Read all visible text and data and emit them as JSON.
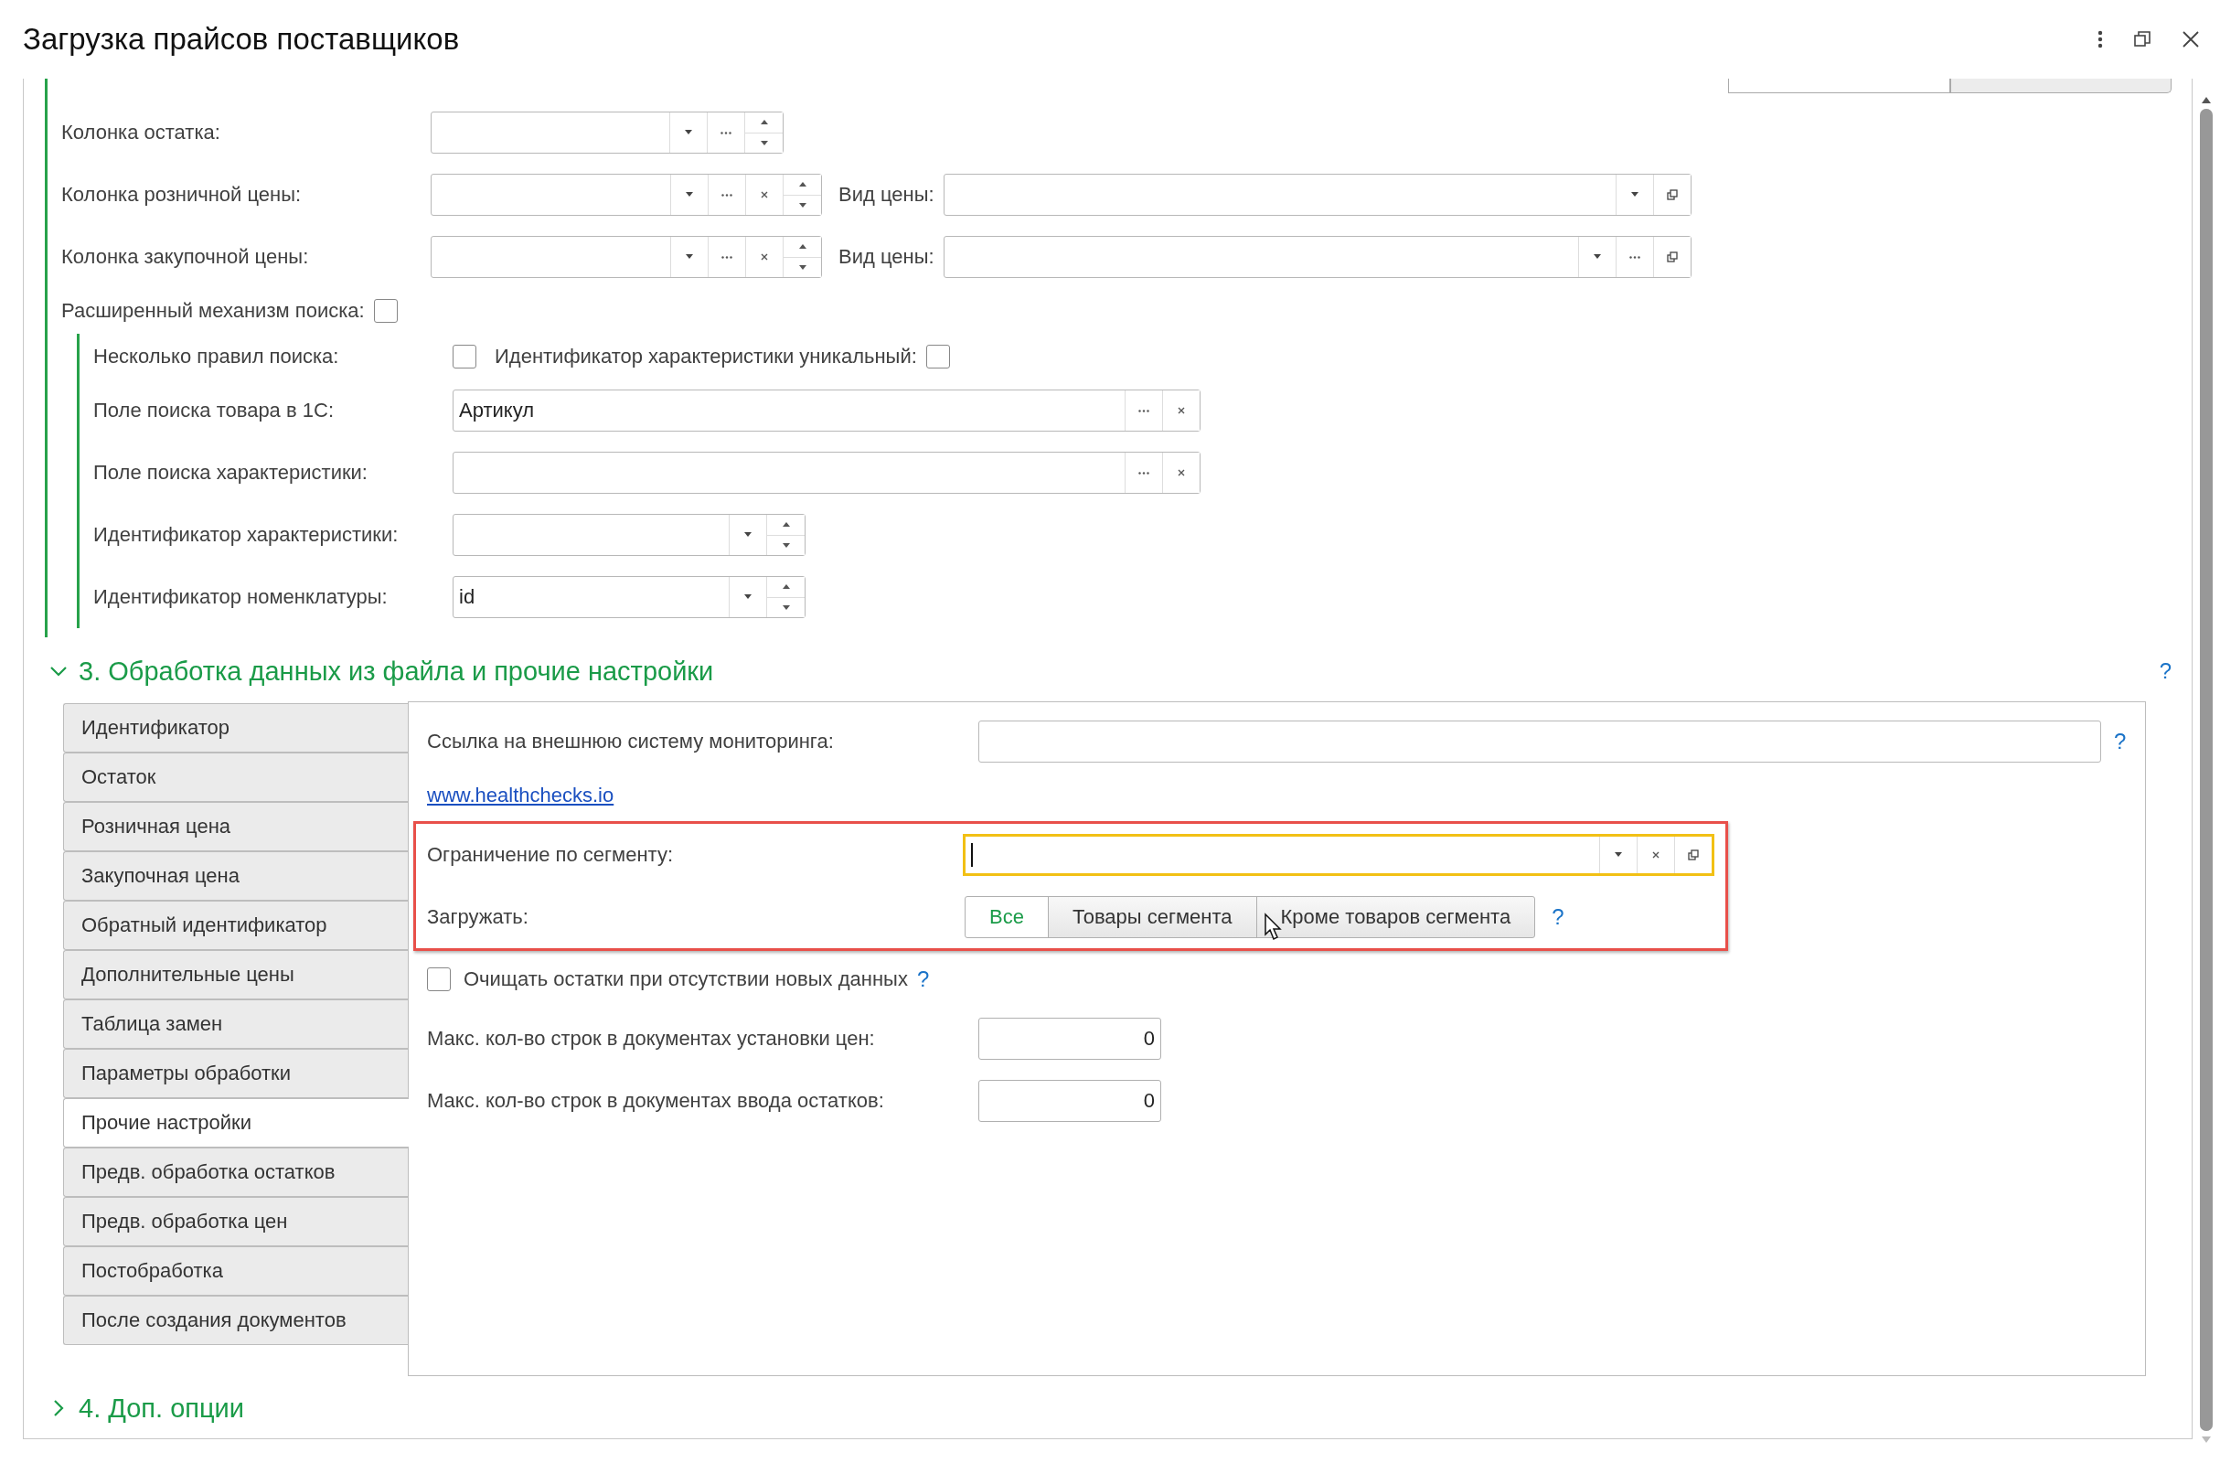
{
  "window": {
    "title": "Загрузка прайсов поставщиков"
  },
  "columns": {
    "rows": [
      {
        "kind": "field",
        "label": "Колонка остатка:",
        "buttons": [
          {
            "kind": "dropdown"
          },
          {
            "kind": "choice"
          },
          {
            "kind": "spin"
          }
        ]
      },
      {
        "kind": "field",
        "label": "Колонка розничной цены:",
        "buttons": [
          {
            "kind": "dropdown"
          },
          {
            "kind": "choice"
          },
          {
            "kind": "clear"
          },
          {
            "kind": "spin"
          }
        ],
        "extra": {
          "label": "Вид цены:",
          "buttons": [
            {
              "kind": "dropdown"
            },
            {
              "kind": "open"
            }
          ]
        }
      },
      {
        "kind": "field",
        "label": "Колонка закупочной цены:",
        "buttons": [
          {
            "kind": "dropdown"
          },
          {
            "kind": "choice"
          },
          {
            "kind": "clear"
          },
          {
            "kind": "spin"
          }
        ],
        "extra": {
          "label": "Вид цены:",
          "buttons": [
            {
              "kind": "dropdown"
            },
            {
              "kind": "choice"
            },
            {
              "kind": "open"
            }
          ]
        }
      },
      {
        "kind": "checkbox",
        "label": "Расширенный механизм поиска:",
        "checked": false
      }
    ]
  },
  "search": {
    "rows": [
      {
        "kind": "checkboxes",
        "items": [
          {
            "label": "Несколько правил поиска:",
            "checked": false
          },
          {
            "label": "Идентификатор характеристики уникальный:",
            "checked": false
          }
        ]
      },
      {
        "kind": "text",
        "label": "Поле поиска товара в 1С:",
        "value": "Артикул",
        "buttons": [
          {
            "kind": "choice"
          },
          {
            "kind": "clear"
          }
        ]
      },
      {
        "kind": "text",
        "label": "Поле поиска характеристики:",
        "buttons": [
          {
            "kind": "choice"
          },
          {
            "kind": "clear"
          }
        ]
      },
      {
        "kind": "field",
        "label": "Идентификатор характеристики:",
        "buttons": [
          {
            "kind": "dropdown"
          },
          {
            "kind": "spin"
          }
        ]
      },
      {
        "kind": "field",
        "label": "Идентификатор номенклатуры:",
        "value": "id",
        "buttons": [
          {
            "kind": "dropdown"
          },
          {
            "kind": "spin"
          }
        ]
      }
    ]
  },
  "processing": {
    "title": "3. Обработка данных из файла и прочие настройки",
    "expanded": true,
    "help": "?",
    "tabs": [
      {
        "label": "Идентификатор",
        "selected": false
      },
      {
        "label": "Остаток",
        "selected": false
      },
      {
        "label": "Розничная цена",
        "selected": false
      },
      {
        "label": "Закупочная цена",
        "selected": false
      },
      {
        "label": "Обратный идентификатор",
        "selected": false
      },
      {
        "label": "Дополнительные цены",
        "selected": false
      },
      {
        "label": "Таблица замен",
        "selected": false
      },
      {
        "label": "Параметры обработки",
        "selected": false
      },
      {
        "label": "Прочие настройки",
        "selected": true
      },
      {
        "label": "Предв. обработка остатков",
        "selected": false
      },
      {
        "label": "Предв. обработка цен",
        "selected": false
      },
      {
        "label": "Постобработка",
        "selected": false
      },
      {
        "label": "После создания документов",
        "selected": false
      }
    ],
    "panel": {
      "monitoring": {
        "label": "Ссылка на внешнюю систему мониторинга:",
        "help": "?"
      },
      "link": "www.healthchecks.io",
      "highlighted": true,
      "segment": {
        "label": "Ограничение по сегменту:",
        "focused": true,
        "buttons": [
          {
            "kind": "dropdown"
          },
          {
            "kind": "clear"
          },
          {
            "kind": "open"
          }
        ]
      },
      "load": {
        "label": "Загружать:",
        "help": "?",
        "options": [
          {
            "label": "Все",
            "selected": true
          },
          {
            "label": "Товары сегмента",
            "selected": false
          },
          {
            "label": "Кроме товаров сегмента",
            "selected": false
          }
        ]
      },
      "clear_stock": {
        "label": "Очищать остатки при отсутствии новых данных",
        "checked": false,
        "help": "?"
      },
      "max_rows": [
        {
          "label": "Макс. кол-во строк в документах установки цен:",
          "value": "0"
        },
        {
          "label": "Макс. кол-во строк в документах ввода остатков:",
          "value": "0"
        }
      ]
    }
  },
  "options_section": {
    "title": "4. Доп. опции",
    "expanded": false
  }
}
